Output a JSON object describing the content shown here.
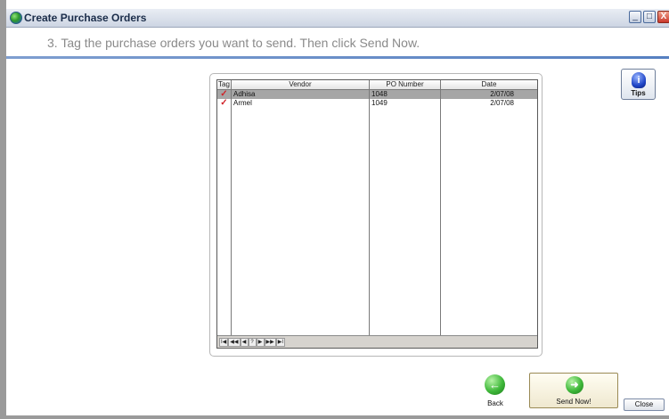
{
  "window": {
    "title": "Create Purchase Orders",
    "minimize_glyph": "_",
    "maximize_glyph": "□",
    "close_glyph": "X"
  },
  "instruction": "3. Tag the purchase orders you want to send. Then click Send Now.",
  "grid": {
    "columns": [
      "Tag",
      "Vendor",
      "PO Number",
      "Date"
    ],
    "rows": [
      {
        "tagged": true,
        "tag_glyph": "✓",
        "vendor": "Adhisa",
        "po_number": "1048",
        "date": "2/07/08",
        "selected": true
      },
      {
        "tagged": true,
        "tag_glyph": "✓",
        "vendor": "Armel",
        "po_number": "1049",
        "date": "2/07/08",
        "selected": false
      }
    ],
    "navigator": {
      "first": "I◀",
      "prev_page": "◀◀",
      "prev": "◀",
      "help": "?",
      "next": "▶",
      "next_page": "▶▶",
      "last": "▶I"
    }
  },
  "buttons": {
    "tips": "Tips",
    "back": "Back",
    "send_now": "Send Now!",
    "close": "Close"
  },
  "icons": {
    "tips": "info-icon",
    "back": "back-arrow-icon",
    "send_now": "send-arrow-icon",
    "app": "app-globe-icon"
  },
  "colors": {
    "accent_divider": "#5680c1",
    "instruction_text": "#8a8a8a",
    "selected_row": "#a6a6a6",
    "tag_check": "#d0242a"
  }
}
